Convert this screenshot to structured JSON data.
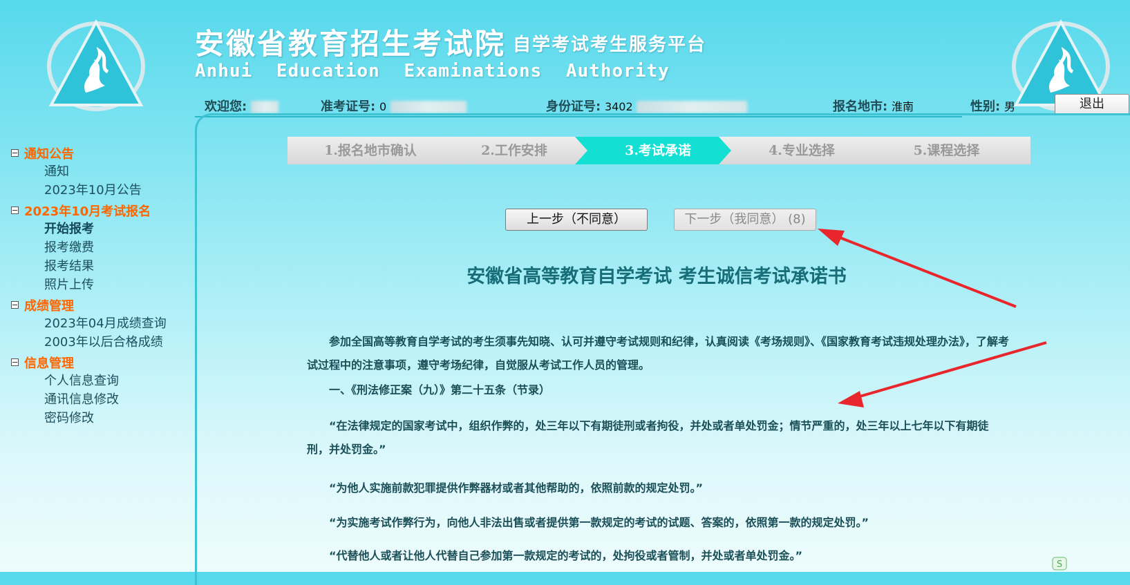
{
  "header": {
    "title_cn": "安徽省教育招生考试院",
    "title_sub": "自学考试考生服务平台",
    "title_en": "Anhui Education Examinations Authority",
    "logout_label": "退出"
  },
  "user_info": {
    "welcome_label": "欢迎您:",
    "welcome_value": "",
    "exam_no_label": "准考证号:",
    "exam_no_value": "0",
    "id_label": "身份证号:",
    "id_value": "3402",
    "city_label": "报名地市:",
    "city_value": "淮南",
    "gender_label": "性别:",
    "gender_value": "男"
  },
  "sidebar": {
    "groups": [
      {
        "title": "通知公告",
        "items": [
          "通知",
          "2023年10月公告"
        ]
      },
      {
        "title": "2023年10月考试报名",
        "items": [
          "开始报考",
          "报考缴费",
          "报考结果",
          "照片上传"
        ]
      },
      {
        "title": "成绩管理",
        "items": [
          "2023年04月成绩查询",
          "2003年以后合格成绩"
        ]
      },
      {
        "title": "信息管理",
        "items": [
          "个人信息查询",
          "通讯信息修改",
          "密码修改"
        ]
      }
    ],
    "active_item": "开始报考"
  },
  "steps": [
    {
      "label": "1.报名地市确认",
      "current": false
    },
    {
      "label": "2.工作安排",
      "current": false
    },
    {
      "label": "3.考试承诺",
      "current": true
    },
    {
      "label": "4.专业选择",
      "current": false
    },
    {
      "label": "5.课程选择",
      "current": false
    }
  ],
  "buttons": {
    "prev_label": "上一步（不同意）",
    "next_label": "下一步（我同意） (8)"
  },
  "document": {
    "title": "安徽省高等教育自学考试 考生诚信考试承诺书",
    "paragraphs": [
      "参加全国高等教育自学考试的考生须事先知晓、认可并遵守考试规则和纪律，认真阅读《考场规则》、《国家教育考试违规处理办法》，了解考试过程中的注意事项，遵守考场纪律，自觉服从考试工作人员的管理。",
      "一、《刑法修正案（九）》第二十五条（节录）",
      "“在法律规定的国家考试中，组织作弊的，处三年以下有期徒刑或者拘役，并处或者单处罚金；情节严重的，处三年以上七年以下有期徒刑，并处罚金。”",
      "“为他人实施前款犯罪提供作弊器材或者其他帮助的，依照前款的规定处罚。”",
      "“为实施考试作弊行为，向他人非法出售或者提供第一款规定的考试的试题、答案的，依照第一款的规定处罚。”",
      "“代替他人或者让他人代替自己参加第一款规定的考试的，处拘役或者管制，并处或者单处罚金。”"
    ]
  },
  "colors": {
    "accent": "#13e0d2",
    "sidebar_heading": "#ff6600",
    "doc_text": "#1a4f58",
    "annotation_arrow": "#e8262b"
  }
}
